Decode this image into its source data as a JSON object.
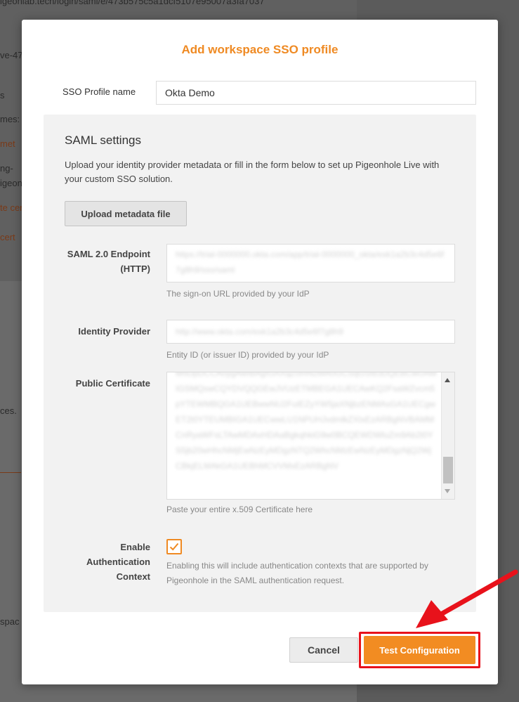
{
  "background": {
    "url_fragment": "igeonlab.tech/login/saml/e/473b575c5a1dcf5107e95007a3fa7037",
    "fragments": [
      "ve-47",
      "s",
      "mes:",
      "met",
      "ng-",
      "igeon",
      "te cer",
      "cert",
      "ces.",
      "spac"
    ]
  },
  "modal": {
    "title": "Add workspace SSO profile",
    "profile_name": {
      "label": "SSO Profile name",
      "value": "Okta Demo"
    },
    "saml": {
      "title": "SAML settings",
      "description": "Upload your identity provider metadata or fill in the form below to set up Pigeonhole Live with your custom SSO solution.",
      "upload_label": "Upload metadata file",
      "endpoint": {
        "label": "SAML 2.0 Endpoint (HTTP)",
        "value": "https://trial-0000000.okta.com/app/trial-0000000_okta/exk1a2b3c4d5e6f7g8h9/sso/saml",
        "help": "The sign-on URL provided by your IdP"
      },
      "idp": {
        "label": "Identity Provider",
        "value": "http://www.okta.com/exk1a2b3c4d5e6f7g8h9",
        "help": "Entity ID (or issuer ID) provided by your IdP"
      },
      "certificate": {
        "label": "Public Certificate",
        "value": "MIIDpDCCAoygAwIBAgIGAXqZ0mN2MA0GCSqGSIb3DQEBCwUAMIGSMQswCQYDVQQGEwJVUzETMBEGA1UECAwKQ2FsaWZvcm5pYTEWMBQGA1UEBwwNU2FuIEZyYW5jaXNjbzENMAsGA1UECgwET2t0YTEUMBIGA1UECwwLU1NPUHJvdmlkZXIxEzARBgNVBAMMCnRyaWFsLTAwMDAxHDAaBgkqhkiG9w0BCQEWDWluZm9Ab2t0YS5jb20wHhcNMjEwNzEyMDgzNTQ2WhcNMzEwNzEyMDgzNjQ2WjCBkjELMAkGA1UEBhMCVVMxEzARBgNV",
        "help": "Paste your entire x.509 Certificate here"
      },
      "auth_context": {
        "label": "Enable Authentication Context",
        "checked": true,
        "help": "Enabling this will include authentication contexts that are supported by Pigeonhole in the SAML authentication request."
      }
    },
    "footer": {
      "cancel_label": "Cancel",
      "test_label": "Test Configuration"
    }
  },
  "colors": {
    "accent": "#ef8a23",
    "highlight": "#e8121b",
    "overlay": "#5b5b5b"
  },
  "icons": {
    "check": "check-icon",
    "pointer": "red-arrow-icon"
  }
}
